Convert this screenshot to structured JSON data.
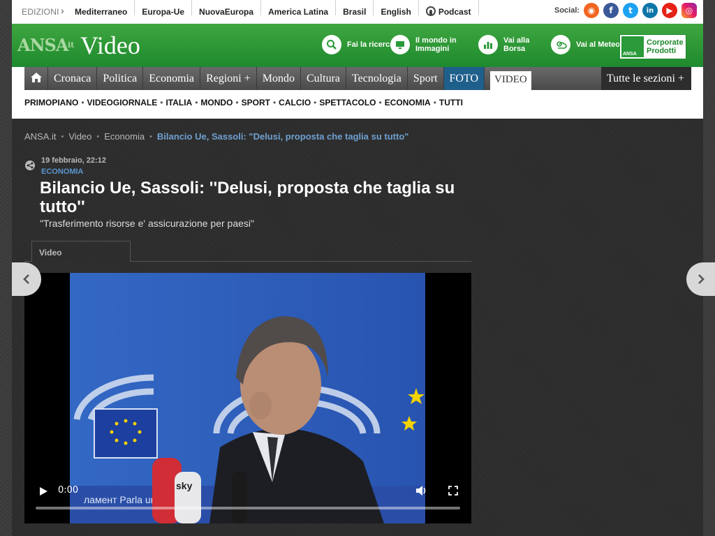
{
  "editions": {
    "label": "EDIZIONI",
    "links": [
      "Mediterraneo",
      "Europa-Ue",
      "NuovaEuropa",
      "America Latina",
      "Brasil",
      "English"
    ],
    "podcast": "Podcast"
  },
  "social": {
    "label": "Social:",
    "icons": [
      "rss-icon",
      "facebook-icon",
      "twitter-icon",
      "linkedin-icon",
      "youtube-icon",
      "instagram-icon"
    ]
  },
  "header": {
    "logo_ansa": "ANSA",
    "logo_it": "it",
    "logo_video": "Video",
    "tools": [
      {
        "label": "Fai la ricerca",
        "icon": "search-icon"
      },
      {
        "label": "Il mondo in Immagini",
        "icon": "monitor-icon"
      },
      {
        "label": "Vai alla Borsa",
        "icon": "chart-icon"
      },
      {
        "label": "Vai al Meteo",
        "icon": "weather-icon"
      }
    ],
    "corporate": {
      "line1": "Corporate",
      "line2": "Prodotti",
      "badge": "ANSA"
    },
    "brand_green": "#2a9a3a"
  },
  "nav": {
    "items": [
      "Cronaca",
      "Politica",
      "Economia",
      "Regioni +",
      "Mondo",
      "Cultura",
      "Tecnologia",
      "Sport",
      "FOTO",
      "VIDEO",
      "Tutte le sezioni +"
    ]
  },
  "subnav": {
    "items": [
      "PRIMOPIANO",
      "VIDEOGIORNALE",
      "ITALIA",
      "MONDO",
      "SPORT",
      "CALCIO",
      "SPETTACOLO",
      "ECONOMIA",
      "TUTTI"
    ]
  },
  "breadcrumb": {
    "items": [
      "ANSA.it",
      "Video",
      "Economia"
    ],
    "current": "Bilancio Ue, Sassoli: \"Delusi, proposta che taglia su tutto\""
  },
  "article": {
    "date": "19 febbraio, 22:12",
    "section": "ECONOMIA",
    "title": "Bilancio Ue, Sassoli: ''Delusi, proposta che taglia su tutto''",
    "subtitle": "\"Trasferimento risorse e' assicurazione per paesi\""
  },
  "tab": {
    "label": "Video"
  },
  "player": {
    "time": "0:00",
    "progress": 0
  }
}
